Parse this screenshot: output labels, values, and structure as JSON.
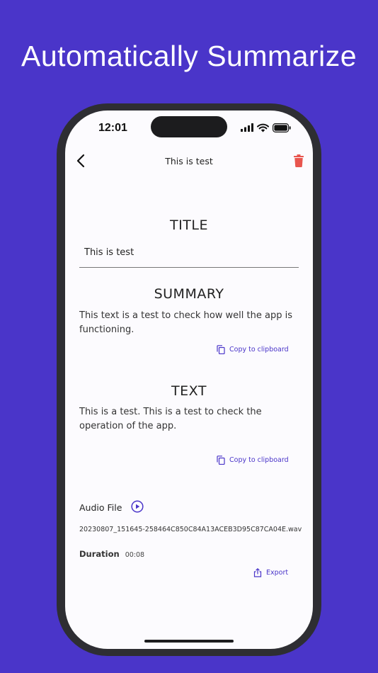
{
  "promo": {
    "headline": "Automatically Summarize"
  },
  "status_bar": {
    "time": "12:01"
  },
  "nav": {
    "title": "This is test",
    "back_icon": "chevron-left-icon",
    "delete_icon": "trash-icon"
  },
  "title_section": {
    "heading": "TITLE",
    "value": "This is test"
  },
  "summary_section": {
    "heading": "SUMMARY",
    "text": "This text is a test to check how well the app is functioning.",
    "copy_label": "Copy to clipboard"
  },
  "text_section": {
    "heading": "TEXT",
    "text": "This is a test. This is a test to check the operation of the app.",
    "copy_label": "Copy to clipboard"
  },
  "audio": {
    "label": "Audio File",
    "filename": "20230807_151645-258464C850C84A13ACEB3D95C87CA04E.wav",
    "duration_label": "Duration",
    "duration_value": "00:08",
    "export_label": "Export"
  },
  "colors": {
    "background": "#4a35c9",
    "accent": "#4a35c9",
    "delete": "#e8554e",
    "screen": "#fcfbfe"
  }
}
